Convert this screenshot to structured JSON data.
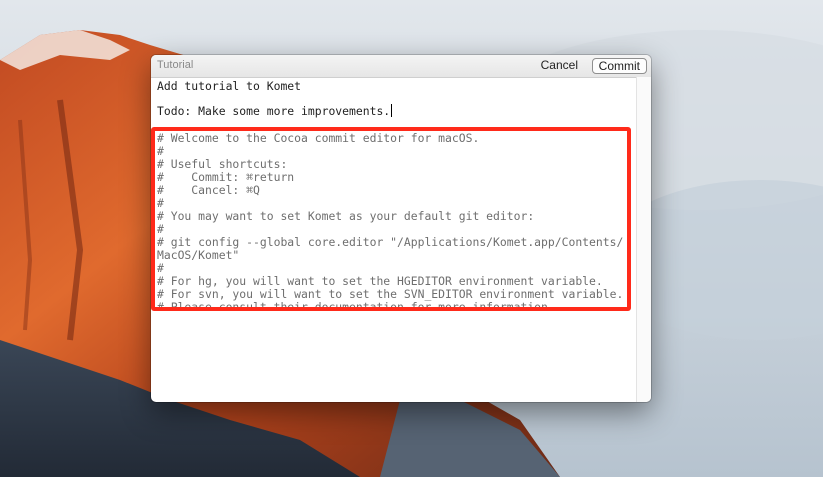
{
  "window": {
    "title": "Tutorial",
    "cancel_label": "Cancel",
    "commit_label": "Commit"
  },
  "editor": {
    "lines": [
      "Add tutorial to Komet",
      "",
      "Todo: Make some more improvements.",
      "",
      "# Welcome to the Cocoa commit editor for macOS.",
      "#",
      "# Useful shortcuts:",
      "#    Commit: ⌘return",
      "#    Cancel: ⌘Q",
      "#",
      "# You may want to set Komet as your default git editor:",
      "#",
      "# git config --global core.editor \"/Applications/Komet.app/Contents/",
      "MacOS/Komet\"",
      "#",
      "# For hg, you will want to set the HGEDITOR environment variable.",
      "# For svn, you will want to set the SVN_EDITOR environment variable.",
      "# Please consult their documentation for more information."
    ]
  },
  "colors": {
    "highlight_border": "#ff2a1a",
    "comment_text": "#6e6e6e"
  }
}
